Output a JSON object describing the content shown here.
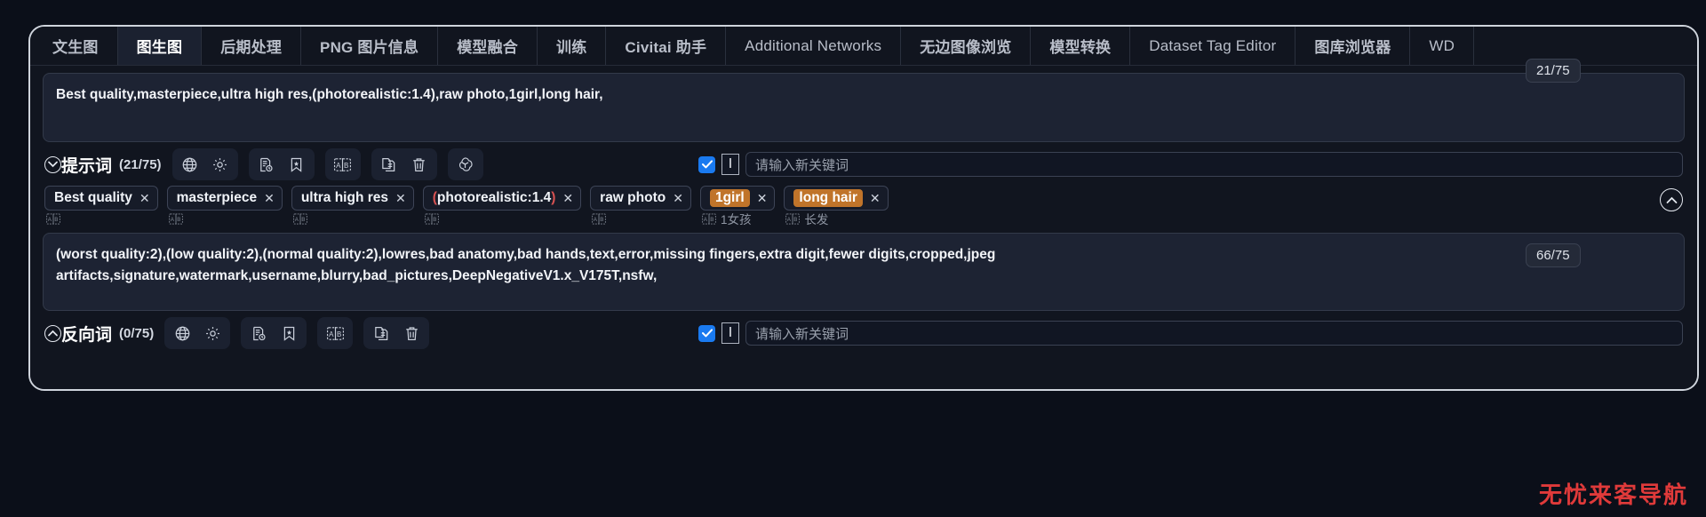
{
  "tabs": [
    {
      "label": "文生图",
      "active": false,
      "cjk": true
    },
    {
      "label": "图生图",
      "active": true,
      "cjk": true
    },
    {
      "label": "后期处理",
      "active": false,
      "cjk": true
    },
    {
      "label": "PNG 图片信息",
      "active": false,
      "cjk": true
    },
    {
      "label": "模型融合",
      "active": false,
      "cjk": true
    },
    {
      "label": "训练",
      "active": false,
      "cjk": true
    },
    {
      "label": "Civitai 助手",
      "active": false,
      "cjk": true
    },
    {
      "label": "Additional Networks",
      "active": false,
      "cjk": false
    },
    {
      "label": "无边图像浏览",
      "active": false,
      "cjk": true
    },
    {
      "label": "模型转换",
      "active": false,
      "cjk": true
    },
    {
      "label": "Dataset Tag Editor",
      "active": false,
      "cjk": false
    },
    {
      "label": "图库浏览器",
      "active": false,
      "cjk": true
    },
    {
      "label": "WD",
      "active": false,
      "cjk": false
    }
  ],
  "positive": {
    "prompt_text": "Best quality,masterpiece,ultra high res,(photorealistic:1.4),raw photo,1girl,long hair,",
    "token_badge": "21/75",
    "section_title": "提示词",
    "section_count": "(21/75)",
    "keyword_placeholder": "请输入新关键词",
    "keyword_value": "",
    "caret_glyph": "I",
    "check_glyph": "✓"
  },
  "negative": {
    "prompt_line1": "(worst quality:2),(low quality:2),(normal quality:2),lowres,bad anatomy,bad hands,text,error,missing fingers,extra digit,fewer digits,cropped,jpeg",
    "prompt_line2": "artifacts,signature,watermark,username,blurry,bad_pictures,DeepNegativeV1.x_V175T,nsfw,",
    "token_badge": "66/75",
    "section_title": "反向词",
    "section_count": "(0/75)",
    "keyword_placeholder": "请输入新关键词",
    "keyword_value": "",
    "caret_glyph": "I",
    "check_glyph": "✓"
  },
  "toolbar_icons": [
    {
      "name": "globe-icon",
      "group": 1
    },
    {
      "name": "gear-icon",
      "group": 1
    },
    {
      "name": "history-icon",
      "group": 2
    },
    {
      "name": "bookmark-star-icon",
      "group": 2
    },
    {
      "name": "translate-ab-icon",
      "group": 3
    },
    {
      "name": "copy-icon",
      "group": 4
    },
    {
      "name": "trash-icon",
      "group": 4
    },
    {
      "name": "openai-icon",
      "group": 5
    }
  ],
  "chips": [
    {
      "text": "Best quality",
      "highlight": false,
      "translation": "",
      "paren": false
    },
    {
      "text": "masterpiece",
      "highlight": false,
      "translation": "",
      "paren": false
    },
    {
      "text": "ultra high res",
      "highlight": false,
      "translation": "",
      "paren": false
    },
    {
      "text": "(photorealistic:1.4)",
      "highlight": false,
      "translation": "",
      "paren": true
    },
    {
      "text": "raw photo",
      "highlight": false,
      "translation": "",
      "paren": false
    },
    {
      "text": "1girl",
      "highlight": true,
      "translation": "1女孩",
      "paren": false
    },
    {
      "text": "long hair",
      "highlight": true,
      "translation": "长发",
      "paren": false
    }
  ],
  "chip_remove_glyph": "✕",
  "watermark": "无忧来客导航",
  "colors": {
    "accent_blue": "#1a7af0",
    "chip_highlight": "#c0742a",
    "paren_red": "#d85252",
    "watermark_red": "#e03a3a"
  }
}
